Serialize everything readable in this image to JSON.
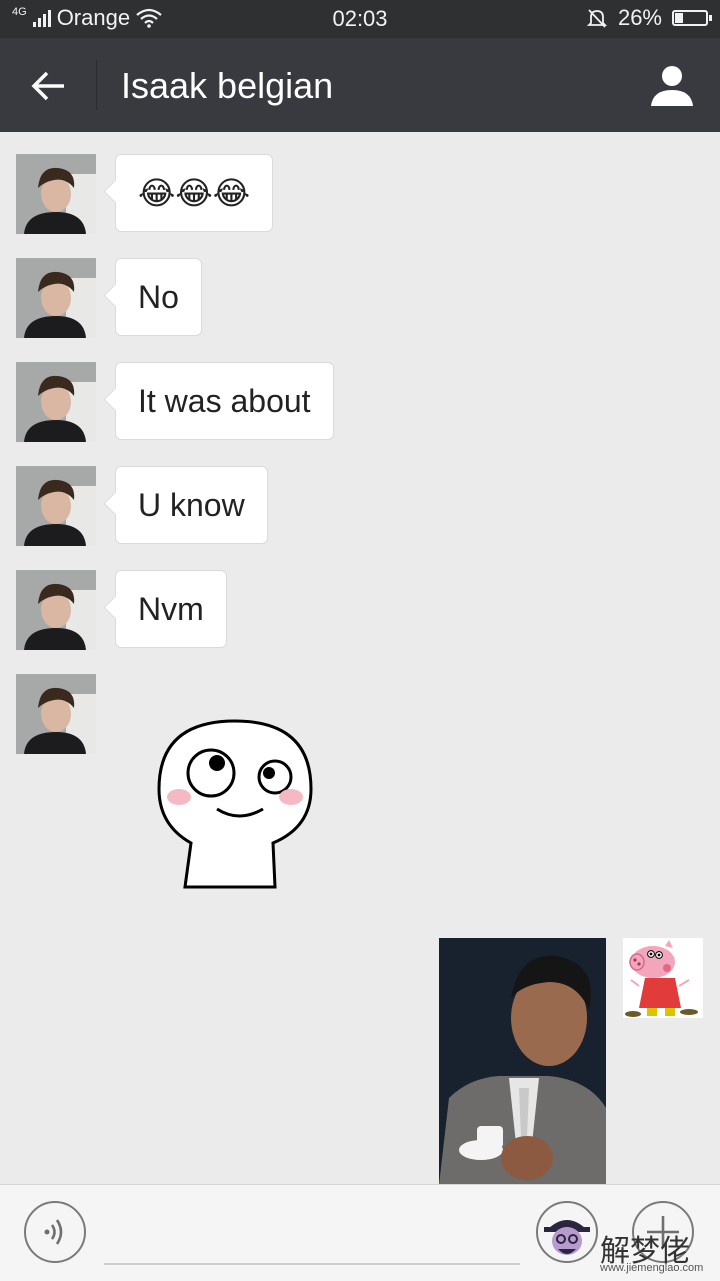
{
  "status_bar": {
    "network": "4G",
    "carrier": "Orange",
    "time": "02:03",
    "battery": "26%",
    "battery_level": 0.26
  },
  "header": {
    "title": "Isaak belgian",
    "icons": {
      "back": "arrow-left-icon",
      "profile": "person-icon"
    }
  },
  "messages": [
    {
      "from": "contact",
      "type": "emoji",
      "text": "😂😂😂",
      "emojis": [
        "😂",
        "😂",
        "😂"
      ]
    },
    {
      "from": "contact",
      "type": "text",
      "text": "No"
    },
    {
      "from": "contact",
      "type": "text",
      "text": "It was about"
    },
    {
      "from": "contact",
      "type": "text",
      "text": "U know"
    },
    {
      "from": "contact",
      "type": "text",
      "text": "Nvm"
    },
    {
      "from": "contact",
      "type": "sticker"
    },
    {
      "from": "me",
      "type": "image"
    }
  ],
  "input_bar": {
    "icons": {
      "voice": "voice-icon",
      "emoji": "emoji-icon",
      "more": "plus-icon"
    }
  },
  "watermark": {
    "text": "解梦佬",
    "url": "www.jiemenglao.com"
  },
  "colors": {
    "status_bg": "#2f3032",
    "header_bg": "#393a3f",
    "chat_bg": "#ebebeb",
    "bubble_bg": "#ffffff"
  }
}
